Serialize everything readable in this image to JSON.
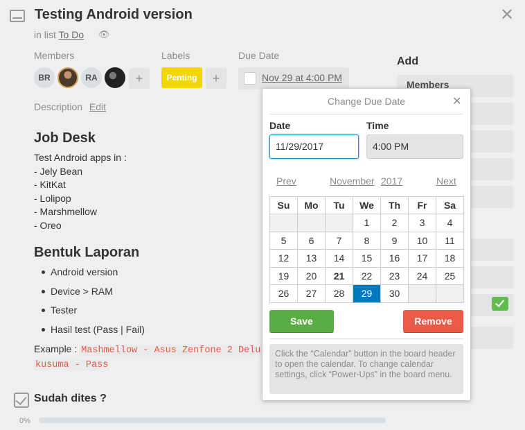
{
  "card": {
    "title": "Testing Android version",
    "in_list_prefix": "in list",
    "list_name": "To Do"
  },
  "members": {
    "label": "Members",
    "avatars": [
      "BR",
      "",
      "RA",
      ""
    ]
  },
  "labels": {
    "label": "Labels",
    "chip": "Penting",
    "chip_color": "#f2d600"
  },
  "due": {
    "label": "Due Date",
    "value": "Nov 29 at 4:00 PM"
  },
  "description": {
    "label": "Description",
    "edit": "Edit",
    "h1": "Job Desk",
    "intro": "Test Android apps in :",
    "versions": [
      "- Jely Bean",
      "- KitKat",
      "- Lolipop",
      "- Marshmellow",
      "- Oreo"
    ],
    "h2": "Bentuk Laporan",
    "bullets": [
      "Android version",
      "Device > RAM",
      "Tester",
      "Hasil test (Pass | Fail)"
    ],
    "example_label": "Example :",
    "example_code1": "Mashmellow - Asus Zenfone 2 Delu",
    "example_code2": "kusuma - Pass"
  },
  "checklist": {
    "title": "Sudah dites ?",
    "percent": "0%",
    "progress": 0
  },
  "sidebar": {
    "add_title": "Add",
    "members_btn": "Members"
  },
  "popup": {
    "title": "Change Due Date",
    "date_label": "Date",
    "date_value": "11/29/2017",
    "time_label": "Time",
    "time_value": "4:00 PM",
    "prev": "Prev",
    "month": "November",
    "year": "2017",
    "next": "Next",
    "weekdays": [
      "Su",
      "Mo",
      "Tu",
      "We",
      "Th",
      "Fr",
      "Sa"
    ],
    "weeks": [
      [
        "",
        "",
        "",
        "1",
        "2",
        "3",
        "4"
      ],
      [
        "5",
        "6",
        "7",
        "8",
        "9",
        "10",
        "11"
      ],
      [
        "12",
        "13",
        "14",
        "15",
        "16",
        "17",
        "18"
      ],
      [
        "19",
        "20",
        "21",
        "22",
        "23",
        "24",
        "25"
      ],
      [
        "26",
        "27",
        "28",
        "29",
        "30",
        "",
        ""
      ]
    ],
    "today": "21",
    "selected": "29",
    "save": "Save",
    "remove": "Remove",
    "hint": "Click the “Calendar” button in the board header to open the calendar. To change calendar settings, click “Power-Ups” in the board menu."
  },
  "colors": {
    "save": "#5aac44",
    "remove": "#eb5a46",
    "selected_day": "#0079bf"
  }
}
